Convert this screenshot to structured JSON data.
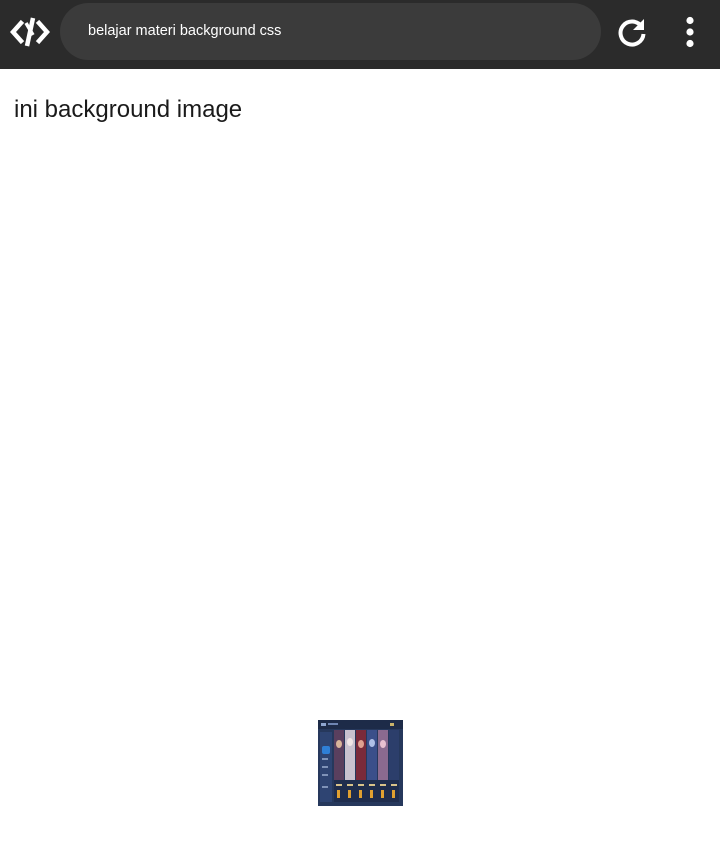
{
  "toolbar": {
    "logo_icon": "code-brackets-logo-icon",
    "title": "belajar materi background css",
    "reload_icon": "reload-icon",
    "menu_icon": "more-vertical-icon"
  },
  "content": {
    "text": "ini background image",
    "background_image": "game-hero-selection-thumbnail"
  },
  "colors": {
    "toolbar_bg": "#2b2b2b",
    "title_pill_bg": "#3b3b3b",
    "page_bg": "#ffffff",
    "text": "#1a1a1a"
  }
}
